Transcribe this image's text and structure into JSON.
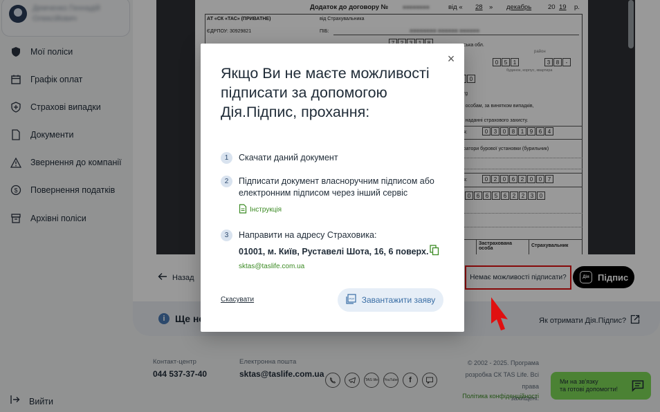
{
  "sidebar": {
    "user_name": "Демченко Геннадій Олексійович",
    "items": [
      {
        "label": "Мої поліси",
        "icon": "shield-icon"
      },
      {
        "label": "Графік оплат",
        "icon": "calendar-icon"
      },
      {
        "label": "Страхові випадки",
        "icon": "shield-plus-icon"
      },
      {
        "label": "Документи",
        "icon": "document-icon"
      },
      {
        "label": "Звернення до компанії",
        "icon": "warning-icon"
      },
      {
        "label": "Повернення податків",
        "icon": "dollar-icon"
      },
      {
        "label": "Архівні поліси",
        "icon": "archive-icon"
      }
    ],
    "logout_label": "Вийти"
  },
  "document": {
    "header": "Додаток до договору №",
    "day": "28",
    "month": "декабрь",
    "year_prefix": "20",
    "year_suffix": "19",
    "year_end": "р.",
    "company": "АТ «СК «ТАС» (ПРИВАТНЕ)",
    "edrpou": "ЄДРПОУ: 30929821",
    "insured_label": "від Страхувальника",
    "pib_label": "ПІБ:",
    "fragments": [
      "адська обл.",
      "район",
      "будинок, корпус, квартира",
      "t.org",
      "им особам, за винятком випадків,",
      "в наданні страхового захисту.",
      "ння:",
      "ператори бурової установки (бурильник)",
      "ння:",
      "Застрахована особа",
      "Страхувальник"
    ],
    "digits_a": [
      "7",
      "2",
      "3",
      "1",
      "8"
    ],
    "digits_b": [
      "0",
      "5",
      "1"
    ],
    "digits_c": [
      "3",
      "8",
      "-"
    ],
    "digits_d": [
      "5",
      "0"
    ],
    "digits_e": [
      "0",
      "3",
      "0",
      "8",
      "1",
      "9",
      "6",
      "4"
    ],
    "digits_f": [
      "0",
      "2",
      "0",
      "6",
      "2",
      "0",
      "0",
      "7"
    ],
    "digits_g": [
      "0",
      "6",
      "6",
      "5",
      "6",
      "2",
      "2",
      "3",
      "0"
    ]
  },
  "actions": {
    "back_label": "Назад",
    "no_sign_label": "Немає можливості підписати?",
    "diia_logo": "Дія",
    "sign_label": "Підпис"
  },
  "info": {
    "text": "Ще не",
    "how_get": "Як отримати Дія.Підпис?"
  },
  "footer": {
    "contact_label": "Контакт-центр",
    "contact_phone": "044 537-37-40",
    "email_label": "Електронна пошта",
    "email": "sktas@taslife.com.ua",
    "socials": [
      "viber",
      "telegram",
      "TAS life",
      "YouTube",
      "f",
      "chat"
    ],
    "copyright_lines": [
      "© 2002 - 2025. Програма",
      "розробка СК TAS Life. Всі права",
      "захищені."
    ],
    "privacy": "Політика конфіденційності",
    "help_lines": [
      "Ми на зв'язку",
      "та готові допомогти!"
    ]
  },
  "modal": {
    "title": "Якщо Ви не маєте можливості підписати за допомогою Дія.Підпис, прохання:",
    "steps": [
      {
        "num": "1",
        "text": "Скачати даний документ"
      },
      {
        "num": "2",
        "text": "Підписати документ власноручним підписом або електронним підписом через інший сервіс"
      },
      {
        "num": "3",
        "text": "Направити на адресу Страховика:"
      }
    ],
    "instruction_label": "Інструкція",
    "address": "01001, м. Київ, Руставелі Шота, 16, 6 поверх.",
    "email": "sktas@taslife.com.ua",
    "cancel_label": "Скасувати",
    "download_label": "Завантажити заяву",
    "close_symbol": "×"
  },
  "colors": {
    "accent_green": "#3b8a23",
    "highlight_red": "#e01010",
    "download_bg": "#e6eef7",
    "help_green": "#7ed957"
  }
}
